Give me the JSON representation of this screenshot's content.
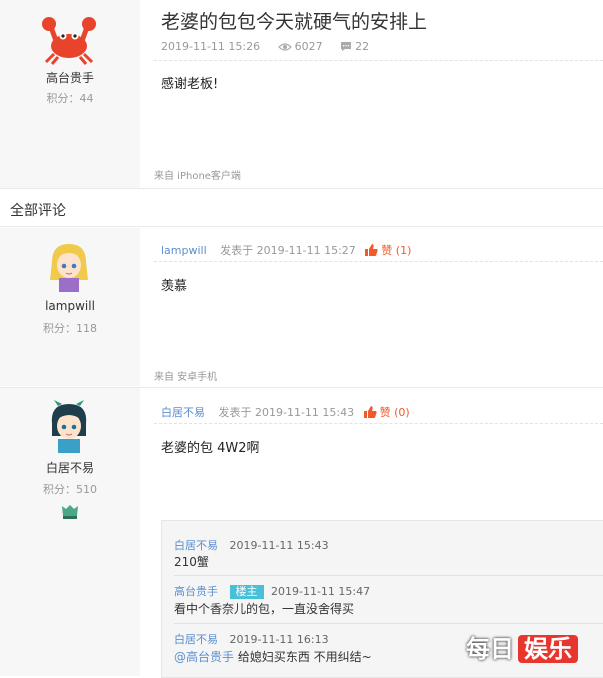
{
  "post": {
    "title": "老婆的包包今天就硬气的安排上",
    "date": "2019-11-11 15:26",
    "views": "6027",
    "comments": "22",
    "content": "感谢老板!",
    "source": "来自 iPhone客户端",
    "author": {
      "name": "高台贵手",
      "score": "积分：44"
    }
  },
  "section_title": "全部评论",
  "comments": [
    {
      "author": {
        "name": "lampwill",
        "score": "积分：118"
      },
      "posted": "发表于 2019-11-11 15:27",
      "like_label": "赞",
      "like_count": "(1)",
      "content": "羡慕",
      "source": "来自 安卓手机"
    },
    {
      "author": {
        "name": "白居不易",
        "score": "积分：510"
      },
      "posted": "发表于 2019-11-11 15:43",
      "like_label": "赞",
      "like_count": "(0)",
      "content": "老婆的包 4W2啊",
      "replies": [
        {
          "name": "白居不易",
          "badge": "",
          "time": "2019-11-11 15:43",
          "text": "210蟹"
        },
        {
          "name": "高台贵手",
          "badge": "楼主",
          "time": "2019-11-11 15:47",
          "text": "看中个香奈儿的包，一直没舍得买"
        },
        {
          "name": "白居不易",
          "badge": "",
          "time": "2019-11-11 16:13",
          "mention": "@高台贵手",
          "text": " 给媳妇买东西 不用纠结~"
        }
      ]
    }
  ],
  "watermark": {
    "part1": "每日",
    "part2": "娱乐"
  },
  "colors": {
    "link": "#5a8fd1",
    "like": "#f25a29",
    "badge": "#48c0d8",
    "watermark_red": "#e8352d"
  },
  "icons": [
    "crab-avatar",
    "anime-blonde-avatar",
    "anime-dark-avatar",
    "eye-icon",
    "comment-icon",
    "thumbs-up-icon",
    "level-badge-icon"
  ]
}
